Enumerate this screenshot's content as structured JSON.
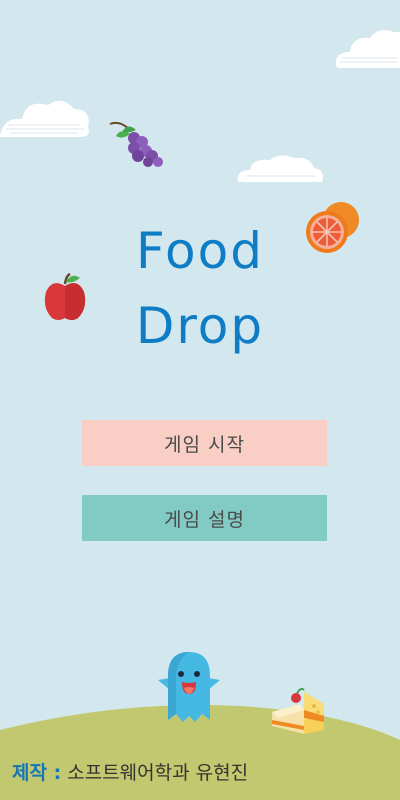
{
  "game": {
    "title_line1": "Food",
    "title_line2": "Drop"
  },
  "menu": {
    "start_label": "게임 시작",
    "howto_label": "게임 설명"
  },
  "credit": {
    "label": "제작 :",
    "text": "소프트웨어학과 유현진"
  },
  "colors": {
    "background": "#d3e7ee",
    "title": "#0f7dc6",
    "start_button": "#f9cec5",
    "howto_button": "#82cbc4",
    "ground": "#c2c86f"
  },
  "icons": [
    "cloud-icon",
    "grape-icon",
    "orange-icon",
    "apple-icon",
    "ghost-icon",
    "cake-icon"
  ]
}
